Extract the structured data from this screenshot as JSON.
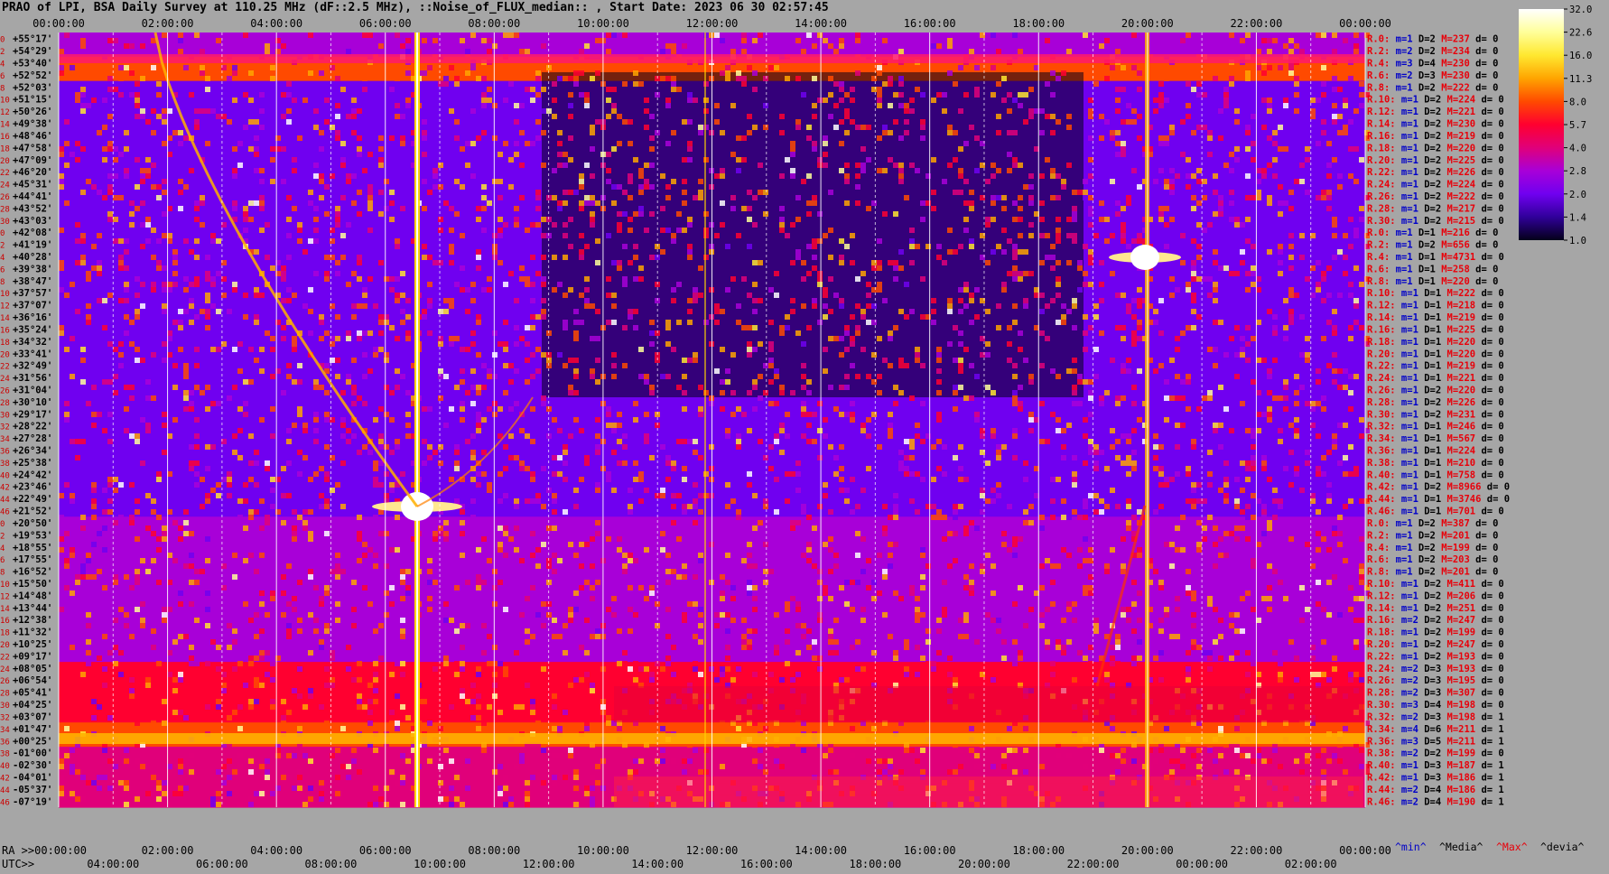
{
  "title": "PRAO of LPI, BSA Daily Survey at 110.25 MHz (dF::2.5 MHz), ::Noise_of_FLUX_median:: , Start Date: 2023 06 30 02:57:45",
  "chart_data": {
    "type": "heatmap",
    "top_ticks": [
      "00:00:00",
      "02:00:00",
      "04:00:00",
      "06:00:00",
      "08:00:00",
      "10:00:00",
      "12:00:00",
      "14:00:00",
      "16:00:00",
      "18:00:00",
      "20:00:00",
      "22:00:00",
      "00:00:00"
    ],
    "ra_ticks": [
      "RA >>00:00:00",
      "02:00:00",
      "04:00:00",
      "06:00:00",
      "08:00:00",
      "10:00:00",
      "12:00:00",
      "14:00:00",
      "16:00:00",
      "18:00:00",
      "20:00:00",
      "22:00:00",
      "00:00:00"
    ],
    "utc_ticks": [
      "UTC>>",
      "04:00:00",
      "06:00:00",
      "08:00:00",
      "10:00:00",
      "12:00:00",
      "14:00:00",
      "16:00:00",
      "18:00:00",
      "20:00:00",
      "22:00:00",
      "00:00:00",
      "02:00:00"
    ],
    "declinations": [
      "+55°17'",
      "+54°29'",
      "+53°40'",
      "+52°52'",
      "+52°03'",
      "+51°15'",
      "+50°26'",
      "+49°38'",
      "+48°46'",
      "+47°58'",
      "+47°09'",
      "+46°20'",
      "+45°31'",
      "+44°41'",
      "+43°52'",
      "+43°03'",
      "+42°08'",
      "+41°19'",
      "+40°28'",
      "+39°38'",
      "+38°47'",
      "+37°57'",
      "+37°07'",
      "+36°16'",
      "+35°24'",
      "+34°32'",
      "+33°41'",
      "+32°49'",
      "+31°56'",
      "+31°04'",
      "+30°10'",
      "+29°17'",
      "+28°22'",
      "+27°28'",
      "+26°34'",
      "+25°38'",
      "+24°42'",
      "+23°46'",
      "+22°49'",
      "+21°52'",
      "+20°50'",
      "+19°53'",
      "+18°55'",
      "+17°55'",
      "+16°52'",
      "+15°50'",
      "+14°48'",
      "+13°44'",
      "+12°38'",
      "+11°32'",
      "+10°25'",
      "+09°17'",
      "+08°05'",
      "+06°54'",
      "+05°41'",
      "+04°25'",
      "+03°07'",
      "+01°47'",
      "+00°25'",
      "-01°00'",
      "-02°30'",
      "-04°01'",
      "-05°37'",
      "-07°19'"
    ],
    "row_numbers": [
      "0",
      "2",
      "4",
      "6",
      "8",
      "10",
      "12",
      "14",
      "16",
      "18",
      "20",
      "22",
      "24",
      "26",
      "28",
      "30",
      "0",
      "2",
      "4",
      "6",
      "8",
      "10",
      "12",
      "14",
      "16",
      "18",
      "20",
      "22",
      "24",
      "26",
      "28",
      "30",
      "32",
      "34",
      "36",
      "38",
      "40",
      "42",
      "44",
      "46",
      "0",
      "2",
      "4",
      "6",
      "8",
      "10",
      "12",
      "14",
      "16",
      "18",
      "20",
      "22",
      "24",
      "26",
      "28",
      "30",
      "32",
      "34",
      "36",
      "38",
      "40",
      "42",
      "44",
      "46"
    ],
    "colorbar": {
      "labels": [
        "32.0",
        "22.6",
        "16.0",
        "11.3",
        "8.0",
        "5.7",
        "4.0",
        "2.8",
        "2.0",
        "1.4",
        "1.0"
      ],
      "colors": [
        "#ffffff",
        "#ffff9a",
        "#ffe830",
        "#ffa400",
        "#ff4a00",
        "#ff0030",
        "#e0007a",
        "#a800d8",
        "#7000f0",
        "#30009a",
        "#04001a"
      ]
    },
    "row_stats": [
      {
        "r": "R.0:",
        "m": "m=1",
        "D": "D=2",
        "M": "M=237",
        "d": "d= 0"
      },
      {
        "r": "R.2:",
        "m": "m=2",
        "D": "D=2",
        "M": "M=234",
        "d": "d= 0"
      },
      {
        "r": "R.4:",
        "m": "m=3",
        "D": "D=4",
        "M": "M=230",
        "d": "d= 0"
      },
      {
        "r": "R.6:",
        "m": "m=2",
        "D": "D=3",
        "M": "M=230",
        "d": "d= 0"
      },
      {
        "r": "R.8:",
        "m": "m=1",
        "D": "D=2",
        "M": "M=222",
        "d": "d= 0"
      },
      {
        "r": "R.10:",
        "m": "m=1",
        "D": "D=2",
        "M": "M=224",
        "d": "d= 0"
      },
      {
        "r": "R.12:",
        "m": "m=1",
        "D": "D=2",
        "M": "M=221",
        "d": "d= 0"
      },
      {
        "r": "R.14:",
        "m": "m=1",
        "D": "D=2",
        "M": "M=230",
        "d": "d= 0"
      },
      {
        "r": "R.16:",
        "m": "m=1",
        "D": "D=2",
        "M": "M=219",
        "d": "d= 0"
      },
      {
        "r": "R.18:",
        "m": "m=1",
        "D": "D=2",
        "M": "M=220",
        "d": "d= 0"
      },
      {
        "r": "R.20:",
        "m": "m=1",
        "D": "D=2",
        "M": "M=225",
        "d": "d= 0"
      },
      {
        "r": "R.22:",
        "m": "m=1",
        "D": "D=2",
        "M": "M=226",
        "d": "d= 0"
      },
      {
        "r": "R.24:",
        "m": "m=1",
        "D": "D=2",
        "M": "M=224",
        "d": "d= 0"
      },
      {
        "r": "R.26:",
        "m": "m=1",
        "D": "D=2",
        "M": "M=222",
        "d": "d= 0"
      },
      {
        "r": "R.28:",
        "m": "m=1",
        "D": "D=2",
        "M": "M=217",
        "d": "d= 0"
      },
      {
        "r": "R.30:",
        "m": "m=1",
        "D": "D=2",
        "M": "M=215",
        "d": "d= 0"
      },
      {
        "r": "R.0:",
        "m": "m=1",
        "D": "D=1",
        "M": "M=216",
        "d": "d= 0"
      },
      {
        "r": "R.2:",
        "m": "m=1",
        "D": "D=2",
        "M": "M=656",
        "d": "d= 0"
      },
      {
        "r": "R.4:",
        "m": "m=1",
        "D": "D=1",
        "M": "M=4731",
        "d": "d= 0"
      },
      {
        "r": "R.6:",
        "m": "m=1",
        "D": "D=1",
        "M": "M=258",
        "d": "d= 0"
      },
      {
        "r": "R.8:",
        "m": "m=1",
        "D": "D=1",
        "M": "M=220",
        "d": "d= 0"
      },
      {
        "r": "R.10:",
        "m": "m=1",
        "D": "D=1",
        "M": "M=222",
        "d": "d= 0"
      },
      {
        "r": "R.12:",
        "m": "m=1",
        "D": "D=1",
        "M": "M=218",
        "d": "d= 0"
      },
      {
        "r": "R.14:",
        "m": "m=1",
        "D": "D=1",
        "M": "M=219",
        "d": "d= 0"
      },
      {
        "r": "R.16:",
        "m": "m=1",
        "D": "D=1",
        "M": "M=225",
        "d": "d= 0"
      },
      {
        "r": "R.18:",
        "m": "m=1",
        "D": "D=1",
        "M": "M=220",
        "d": "d= 0"
      },
      {
        "r": "R.20:",
        "m": "m=1",
        "D": "D=1",
        "M": "M=220",
        "d": "d= 0"
      },
      {
        "r": "R.22:",
        "m": "m=1",
        "D": "D=1",
        "M": "M=219",
        "d": "d= 0"
      },
      {
        "r": "R.24:",
        "m": "m=1",
        "D": "D=1",
        "M": "M=221",
        "d": "d= 0"
      },
      {
        "r": "R.26:",
        "m": "m=1",
        "D": "D=2",
        "M": "M=220",
        "d": "d= 0"
      },
      {
        "r": "R.28:",
        "m": "m=1",
        "D": "D=2",
        "M": "M=226",
        "d": "d= 0"
      },
      {
        "r": "R.30:",
        "m": "m=1",
        "D": "D=2",
        "M": "M=231",
        "d": "d= 0"
      },
      {
        "r": "R.32:",
        "m": "m=1",
        "D": "D=1",
        "M": "M=246",
        "d": "d= 0"
      },
      {
        "r": "R.34:",
        "m": "m=1",
        "D": "D=1",
        "M": "M=567",
        "d": "d= 0"
      },
      {
        "r": "R.36:",
        "m": "m=1",
        "D": "D=1",
        "M": "M=224",
        "d": "d= 0"
      },
      {
        "r": "R.38:",
        "m": "m=1",
        "D": "D=1",
        "M": "M=210",
        "d": "d= 0"
      },
      {
        "r": "R.40:",
        "m": "m=1",
        "D": "D=1",
        "M": "M=758",
        "d": "d= 0"
      },
      {
        "r": "R.42:",
        "m": "m=1",
        "D": "D=2",
        "M": "M=8966",
        "d": "d= 0"
      },
      {
        "r": "R.44:",
        "m": "m=1",
        "D": "D=1",
        "M": "M=3746",
        "d": "d= 0"
      },
      {
        "r": "R.46:",
        "m": "m=1",
        "D": "D=1",
        "M": "M=701",
        "d": "d= 0"
      },
      {
        "r": "R.0:",
        "m": "m=1",
        "D": "D=2",
        "M": "M=387",
        "d": "d= 0"
      },
      {
        "r": "R.2:",
        "m": "m=1",
        "D": "D=2",
        "M": "M=201",
        "d": "d= 0"
      },
      {
        "r": "R.4:",
        "m": "m=1",
        "D": "D=2",
        "M": "M=199",
        "d": "d= 0"
      },
      {
        "r": "R.6:",
        "m": "m=1",
        "D": "D=2",
        "M": "M=203",
        "d": "d= 0"
      },
      {
        "r": "R.8:",
        "m": "m=1",
        "D": "D=2",
        "M": "M=201",
        "d": "d= 0"
      },
      {
        "r": "R.10:",
        "m": "m=1",
        "D": "D=2",
        "M": "M=411",
        "d": "d= 0"
      },
      {
        "r": "R.12:",
        "m": "m=1",
        "D": "D=2",
        "M": "M=206",
        "d": "d= 0"
      },
      {
        "r": "R.14:",
        "m": "m=1",
        "D": "D=2",
        "M": "M=251",
        "d": "d= 0"
      },
      {
        "r": "R.16:",
        "m": "m=2",
        "D": "D=2",
        "M": "M=247",
        "d": "d= 0"
      },
      {
        "r": "R.18:",
        "m": "m=1",
        "D": "D=2",
        "M": "M=199",
        "d": "d= 0"
      },
      {
        "r": "R.20:",
        "m": "m=1",
        "D": "D=2",
        "M": "M=247",
        "d": "d= 0"
      },
      {
        "r": "R.22:",
        "m": "m=1",
        "D": "D=2",
        "M": "M=193",
        "d": "d= 0"
      },
      {
        "r": "R.24:",
        "m": "m=2",
        "D": "D=3",
        "M": "M=193",
        "d": "d= 0"
      },
      {
        "r": "R.26:",
        "m": "m=2",
        "D": "D=3",
        "M": "M=195",
        "d": "d= 0"
      },
      {
        "r": "R.28:",
        "m": "m=2",
        "D": "D=3",
        "M": "M=307",
        "d": "d= 0"
      },
      {
        "r": "R.30:",
        "m": "m=3",
        "D": "D=4",
        "M": "M=198",
        "d": "d= 0"
      },
      {
        "r": "R.32:",
        "m": "m=2",
        "D": "D=3",
        "M": "M=198",
        "d": "d= 1"
      },
      {
        "r": "R.34:",
        "m": "m=4",
        "D": "D=6",
        "M": "M=211",
        "d": "d= 1"
      },
      {
        "r": "R.36:",
        "m": "m=3",
        "D": "D=5",
        "M": "M=211",
        "d": "d= 1"
      },
      {
        "r": "R.38:",
        "m": "m=2",
        "D": "D=2",
        "M": "M=199",
        "d": "d= 0"
      },
      {
        "r": "R.40:",
        "m": "m=1",
        "D": "D=3",
        "M": "M=187",
        "d": "d= 1"
      },
      {
        "r": "R.42:",
        "m": "m=1",
        "D": "D=3",
        "M": "M=186",
        "d": "d= 1"
      },
      {
        "r": "R.44:",
        "m": "m=2",
        "D": "D=4",
        "M": "M=186",
        "d": "d= 1"
      },
      {
        "r": "R.46:",
        "m": "m=2",
        "D": "D=4",
        "M": "M=190",
        "d": "d= 1"
      }
    ],
    "stats_legend": [
      "^min^",
      "^Media^",
      "^Max^",
      "^devia^"
    ],
    "stats_colors": {
      "r": "#e8000a",
      "m": "#0000c8",
      "D": "#000000",
      "M": "#e8000a",
      "d": "#000000"
    }
  }
}
